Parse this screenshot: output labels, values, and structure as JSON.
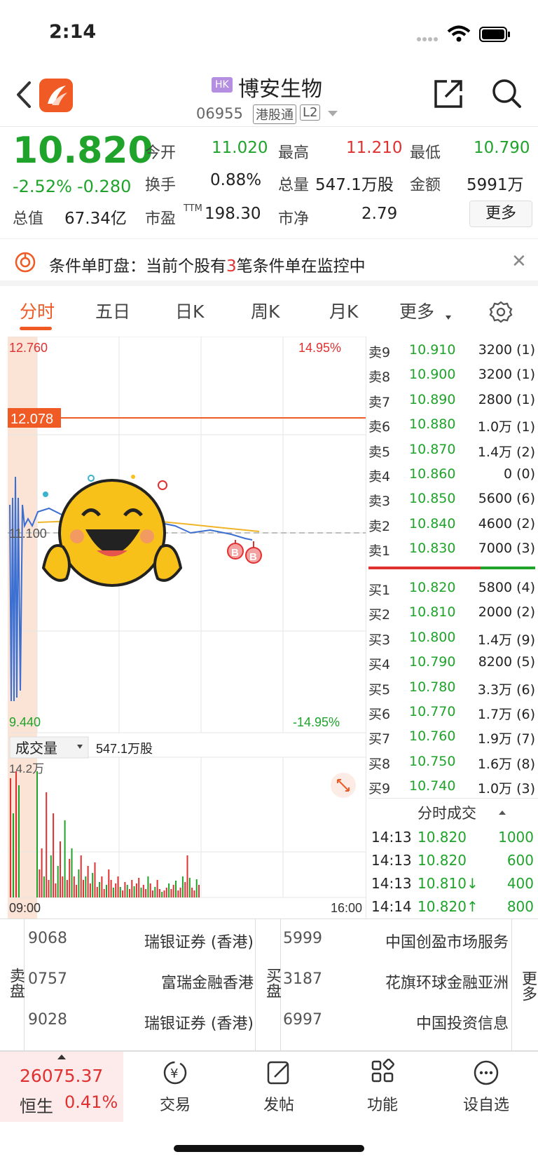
{
  "status": {
    "time": "2:14"
  },
  "header": {
    "market_badge": "HK",
    "name": "博安生物",
    "code": "06955",
    "tag_connect": "港股通",
    "tag_level": "L2"
  },
  "quote": {
    "price": "10.820",
    "change_pct": "-2.52%",
    "change_abs": "-0.280",
    "open_label": "今开",
    "open": "11.020",
    "high_label": "最高",
    "high": "11.210",
    "low_label": "最低",
    "low": "10.790",
    "turnover_label": "换手",
    "turnover": "0.88%",
    "volume_label": "总量",
    "volume": "547.1万股",
    "amount_label": "金额",
    "amount": "5991万",
    "mktcap_label": "总值",
    "mktcap": "67.34亿",
    "pe_label": "市盈",
    "pe_sup": "TTM",
    "pe": "198.30",
    "pb_label": "市净",
    "pb": "2.79",
    "more_button": "更多"
  },
  "condition_banner": {
    "prefix": "条件单盯盘：当前个股有",
    "count": "3",
    "suffix": "笔条件单在监控中"
  },
  "tabs": [
    "分时",
    "五日",
    "日K",
    "周K",
    "月K",
    "更多"
  ],
  "intraday": {
    "price_high": "12.760",
    "price_low": "9.440",
    "pct_high": "14.95%",
    "pct_low": "-14.95%",
    "alert_line": "12.078",
    "prev_close": "11.100",
    "volume_selector": "成交量",
    "volume_total": "547.1万股",
    "volume_max": "14.2万",
    "time_start": "09:00",
    "time_end": "16:00",
    "buy_marker": "B",
    "colors": {
      "up": "#e03131",
      "down": "#1fa32b",
      "line": "#3b6fd1",
      "avg": "#f0b429",
      "alert": "#f05a24"
    }
  },
  "order_book": {
    "asks": [
      {
        "label": "卖9",
        "price": "10.910",
        "vol": "3200 (1)"
      },
      {
        "label": "卖8",
        "price": "10.900",
        "vol": "3200 (1)"
      },
      {
        "label": "卖7",
        "price": "10.890",
        "vol": "2800 (1)"
      },
      {
        "label": "卖6",
        "price": "10.880",
        "vol": "1.0万 (1)"
      },
      {
        "label": "卖5",
        "price": "10.870",
        "vol": "1.4万 (2)"
      },
      {
        "label": "卖4",
        "price": "10.860",
        "vol": "0 (0)"
      },
      {
        "label": "卖3",
        "price": "10.850",
        "vol": "5600 (6)"
      },
      {
        "label": "卖2",
        "price": "10.840",
        "vol": "4600 (2)"
      },
      {
        "label": "卖1",
        "price": "10.830",
        "vol": "7000 (3)"
      }
    ],
    "bids": [
      {
        "label": "买1",
        "price": "10.820",
        "vol": "5800 (4)"
      },
      {
        "label": "买2",
        "price": "10.810",
        "vol": "2000 (2)"
      },
      {
        "label": "买3",
        "price": "10.800",
        "vol": "1.4万 (9)"
      },
      {
        "label": "买4",
        "price": "10.790",
        "vol": "8200 (5)"
      },
      {
        "label": "买5",
        "price": "10.780",
        "vol": "3.3万 (6)"
      },
      {
        "label": "买6",
        "price": "10.770",
        "vol": "1.7万 (6)"
      },
      {
        "label": "买7",
        "price": "10.760",
        "vol": "1.9万 (7)"
      },
      {
        "label": "买8",
        "price": "10.750",
        "vol": "1.6万 (8)"
      },
      {
        "label": "买9",
        "price": "10.740",
        "vol": "1.0万 (3)"
      }
    ],
    "trades_title": "分时成交",
    "trades": [
      {
        "time": "14:13",
        "price": "10.820",
        "vol": "1000",
        "arrow": ""
      },
      {
        "time": "14:13",
        "price": "10.820",
        "vol": "600",
        "arrow": ""
      },
      {
        "time": "14:13",
        "price": "10.810↓",
        "vol": "400",
        "arrow": "down"
      },
      {
        "time": "14:14",
        "price": "10.820↑",
        "vol": "800",
        "arrow": "up"
      }
    ]
  },
  "brokers": {
    "sell_label": "卖盘",
    "buy_label": "买盘",
    "more_label": "更多",
    "sell": [
      {
        "code": "9068",
        "name": "瑞银证券 (香港)"
      },
      {
        "code": "0757",
        "name": "富瑞金融香港"
      },
      {
        "code": "9028",
        "name": "瑞银证券 (香港)"
      }
    ],
    "buy": [
      {
        "code": "5999",
        "name": "中国创盈市场服务"
      },
      {
        "code": "3187",
        "name": "花旗环球金融亚洲"
      },
      {
        "code": "6997",
        "name": "中国投资信息"
      }
    ]
  },
  "bottom_nav": {
    "index_value": "26075.37",
    "index_name": "恒生",
    "index_pct": "0.41%",
    "items": [
      "交易",
      "发帖",
      "功能",
      "设自选"
    ]
  }
}
